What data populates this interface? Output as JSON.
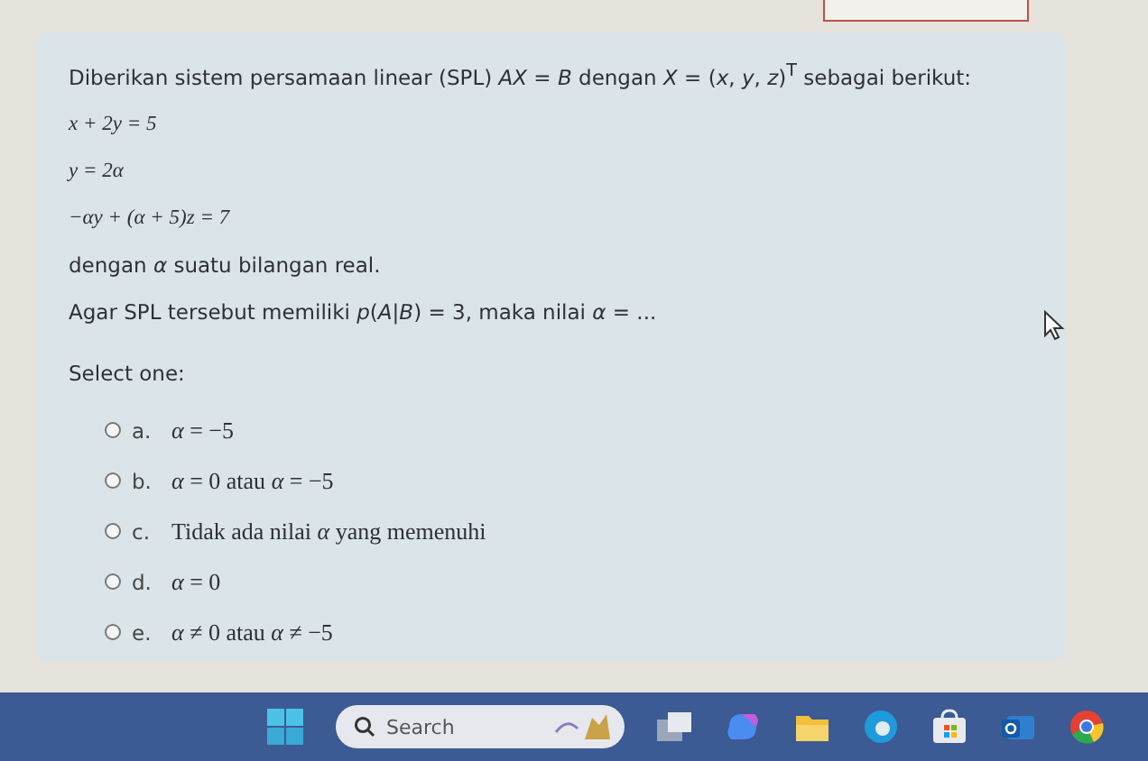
{
  "question": {
    "intro": "Diberikan sistem persamaan linear (SPL) *AX* = *B* dengan *X* = (*x*, *y*, *z*)$^{T}$ sebagai berikut:",
    "equations": [
      "x + 2y = 5",
      "y = 2α",
      "−αy + (α + 5)z = 7"
    ],
    "note": "dengan *α* suatu bilangan real.",
    "prompt": "Agar SPL tersebut memiliki *p*(*A*|*B*) = 3, maka nilai *α* = ..."
  },
  "select_label": "Select one:",
  "options": [
    {
      "letter": "a.",
      "text": "*α* = −5",
      "selected": false
    },
    {
      "letter": "b.",
      "text": "*α* = 0 atau *α* = −5",
      "selected": false
    },
    {
      "letter": "c.",
      "text": "Tidak ada nilai *α* yang memenuhi",
      "selected": false
    },
    {
      "letter": "d.",
      "text": "*α* = 0",
      "selected": false
    },
    {
      "letter": "e.",
      "text": "*α* ≠ 0 atau *α* ≠ −5",
      "selected": false
    }
  ],
  "taskbar": {
    "search_placeholder": "Search"
  }
}
